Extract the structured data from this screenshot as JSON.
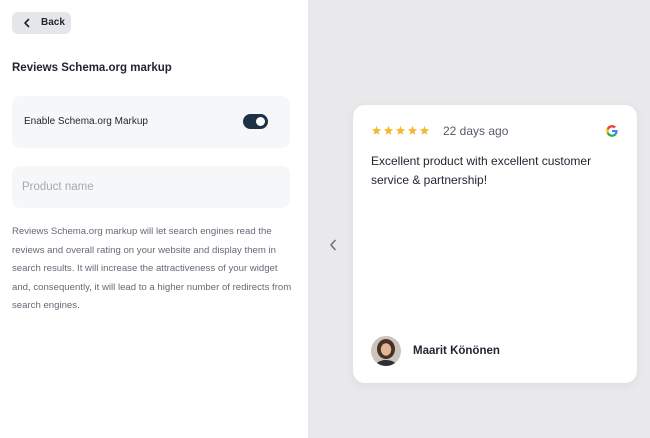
{
  "header": {
    "back_label": "Back"
  },
  "section": {
    "title": "Reviews Schema.org markup"
  },
  "toggle": {
    "label": "Enable Schema.org Markup",
    "enabled": true
  },
  "product": {
    "placeholder": "Product name",
    "value": ""
  },
  "description": "Reviews Schema.org markup will let search engines read the reviews and overall rating on your website and display them in search results. It will increase the attractiveness of your widget and, consequently, it will lead to a higher number of redirects from search engines.",
  "review": {
    "rating": 5,
    "date": "22 days ago",
    "source_icon": "google-icon",
    "text": "Excellent product with excellent customer service & partnership!",
    "author": "Maarit Könönen"
  },
  "colors": {
    "star": "#f5b82e",
    "toggle_on": "#1d3147",
    "panel_bg": "#ffffff",
    "page_bg": "#e9e9eb"
  }
}
